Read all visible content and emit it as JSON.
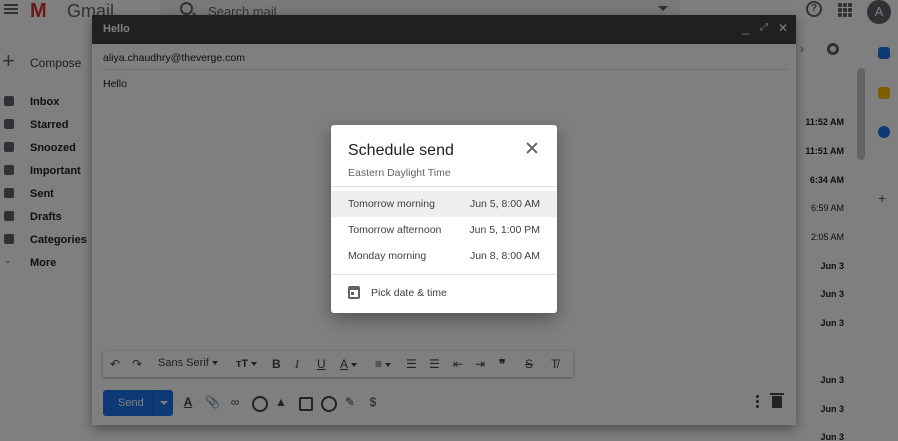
{
  "gmail": {
    "logo_text": "Gmail",
    "search_placeholder": "Search mail",
    "avatar_initial": "A",
    "compose_label": "Compose",
    "nav": [
      "Inbox",
      "Starred",
      "Snoozed",
      "Important",
      "Sent",
      "Drafts",
      "Categories",
      "More"
    ],
    "mail_times": [
      "11:52 AM",
      "11:51 AM",
      "6:34 AM",
      "6:59 AM",
      "2:05 AM",
      "Jun 3",
      "Jun 3",
      "Jun 3",
      "Jun 3",
      "Jun 3",
      "Jun 3"
    ]
  },
  "compose": {
    "title": "Hello",
    "to": "aliya.chaudhry@theverge.com",
    "body": "Hello",
    "font_name": "Sans Serif",
    "send_label": "Send"
  },
  "schedule_dialog": {
    "title": "Schedule send",
    "timezone": "Eastern Daylight Time",
    "options": [
      {
        "label": "Tomorrow morning",
        "date": "Jun 5, 8:00 AM"
      },
      {
        "label": "Tomorrow afternoon",
        "date": "Jun 5, 1:00 PM"
      },
      {
        "label": "Monday morning",
        "date": "Jun 8, 8:00 AM"
      }
    ],
    "pick_label": "Pick date & time"
  }
}
